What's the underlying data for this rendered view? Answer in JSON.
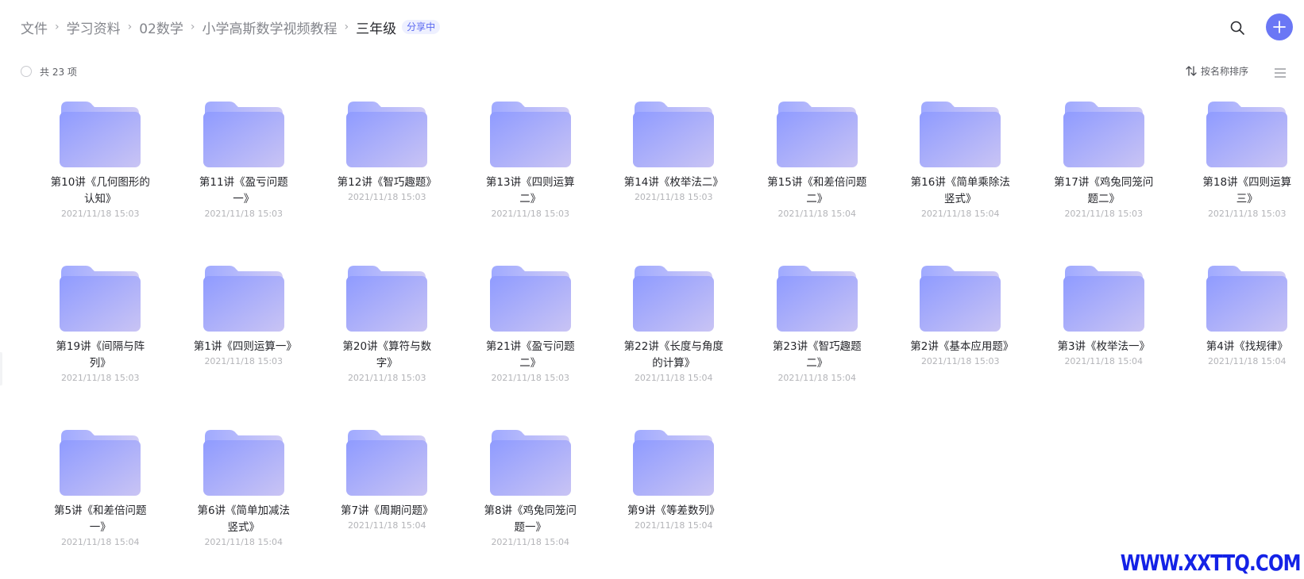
{
  "breadcrumb": {
    "items": [
      "文件",
      "学习资料",
      "02数学",
      "小学高斯数学视频教程"
    ],
    "current": "三年级",
    "separator": "›",
    "badge": "分享中"
  },
  "toolbar": {
    "count_label": "共 23 项",
    "sort_label": "按名称排序"
  },
  "colors": {
    "accent": "#6a77f5",
    "folder_top": "#8f9bff",
    "folder_bottom": "#c9c4f4"
  },
  "folders": [
    {
      "name": "第10讲《几何图形的认知》",
      "date": "2021/11/18 15:03"
    },
    {
      "name": "第11讲《盈亏问题一》",
      "date": "2021/11/18 15:03"
    },
    {
      "name": "第12讲《智巧趣题》",
      "date": "2021/11/18 15:03"
    },
    {
      "name": "第13讲《四则运算二》",
      "date": "2021/11/18 15:03"
    },
    {
      "name": "第14讲《枚举法二》",
      "date": "2021/11/18 15:03"
    },
    {
      "name": "第15讲《和差倍问题二》",
      "date": "2021/11/18 15:04"
    },
    {
      "name": "第16讲《简单乘除法竖式》",
      "date": "2021/11/18 15:04"
    },
    {
      "name": "第17讲《鸡兔同笼问题二》",
      "date": "2021/11/18 15:03"
    },
    {
      "name": "第18讲《四则运算三》",
      "date": "2021/11/18 15:03"
    },
    {
      "name": "第19讲《间隔与阵列》",
      "date": "2021/11/18 15:03"
    },
    {
      "name": "第1讲《四则运算一》",
      "date": "2021/11/18 15:03"
    },
    {
      "name": "第20讲《算符与数字》",
      "date": "2021/11/18 15:03"
    },
    {
      "name": "第21讲《盈亏问题二》",
      "date": "2021/11/18 15:03"
    },
    {
      "name": "第22讲《长度与角度的计算》",
      "date": "2021/11/18 15:04"
    },
    {
      "name": "第23讲《智巧趣题二》",
      "date": "2021/11/18 15:04"
    },
    {
      "name": "第2讲《基本应用题》",
      "date": "2021/11/18 15:03"
    },
    {
      "name": "第3讲《枚举法一》",
      "date": "2021/11/18 15:04"
    },
    {
      "name": "第4讲《找规律》",
      "date": "2021/11/18 15:04"
    },
    {
      "name": "第5讲《和差倍问题一》",
      "date": "2021/11/18 15:04"
    },
    {
      "name": "第6讲《简单加减法竖式》",
      "date": "2021/11/18 15:04"
    },
    {
      "name": "第7讲《周期问题》",
      "date": "2021/11/18 15:04"
    },
    {
      "name": "第8讲《鸡兔同笼问题一》",
      "date": "2021/11/18 15:04"
    },
    {
      "name": "第9讲《等差数列》",
      "date": "2021/11/18 15:04"
    }
  ],
  "watermark": "WWW.XXTTQ.COM"
}
